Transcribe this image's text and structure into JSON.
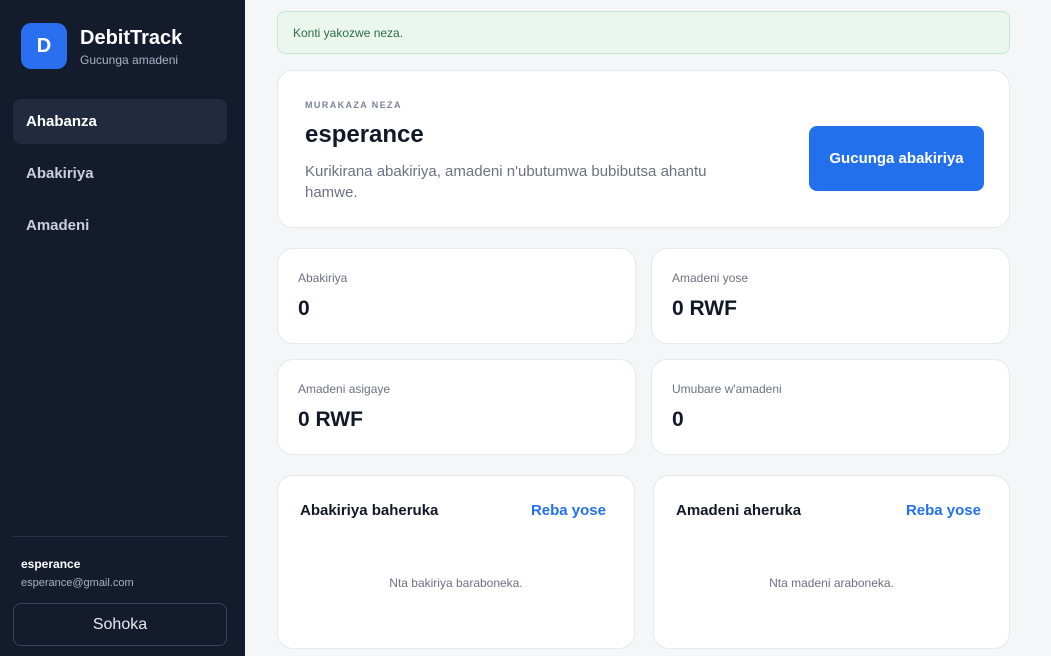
{
  "brand": {
    "logo_letter": "D",
    "name": "DebitTrack",
    "subtitle": "Gucunga amadeni"
  },
  "nav": [
    {
      "label": "Ahabanza",
      "active": true
    },
    {
      "label": "Abakiriya",
      "active": false
    },
    {
      "label": "Amadeni",
      "active": false
    }
  ],
  "user": {
    "name": "esperance",
    "email": "esperance@gmail.com"
  },
  "logout_label": "Sohoka",
  "alert": "Konti yakozwe neza.",
  "welcome": {
    "kicker": "MURAKAZA NEZA",
    "title": "esperance",
    "description": "Kurikirana abakiriya, amadeni n'ubutumwa bubibutsa ahantu hamwe.",
    "button": "Gucunga abakiriya"
  },
  "stats": [
    {
      "label": "Abakiriya",
      "value": "0"
    },
    {
      "label": "Amadeni yose",
      "value": "0 RWF"
    },
    {
      "label": "Amadeni asigaye",
      "value": "0 RWF"
    },
    {
      "label": "Umubare w'amadeni",
      "value": "0"
    }
  ],
  "recent_clients": {
    "title": "Abakiriya baheruka",
    "link": "Reba yose",
    "empty": "Nta bakiriya baraboneka."
  },
  "recent_debts": {
    "title": "Amadeni aheruka",
    "link": "Reba yose",
    "empty": "Nta madeni araboneka."
  },
  "colors": {
    "sidebar": "#141b2d",
    "accent": "#2370ec",
    "alert_bg": "#eaf6ee",
    "alert_text": "#2f6b46"
  }
}
